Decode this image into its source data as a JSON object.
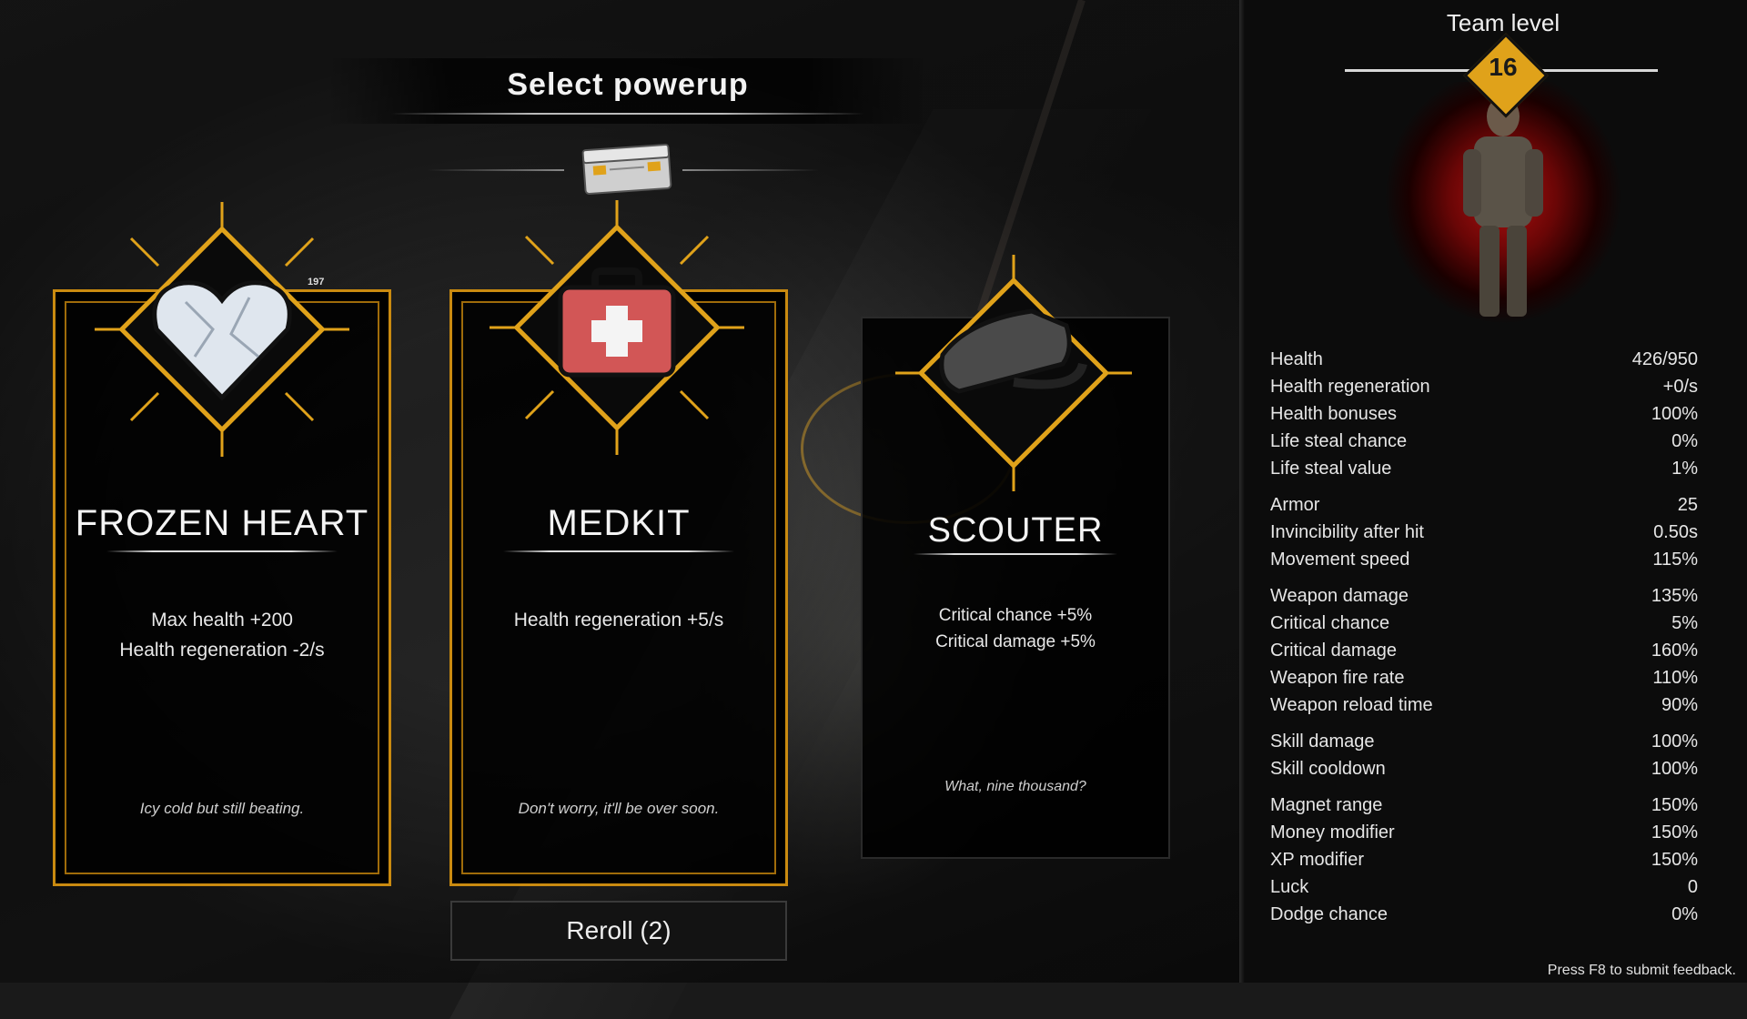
{
  "header": {
    "title": "Select powerup"
  },
  "cards": [
    {
      "name": "FROZEN HEART",
      "effects": [
        "Max health +200",
        "Health regeneration -2/s"
      ],
      "flavor": "Icy cold but still beating.",
      "badge": "197",
      "icon": "frozen-heart-icon"
    },
    {
      "name": "MEDKIT",
      "effects": [
        "Health regeneration +5/s"
      ],
      "flavor": "Don't worry, it'll be over soon.",
      "icon": "medkit-icon"
    },
    {
      "name": "SCOUTER",
      "effects": [
        "Critical chance +5%",
        "Critical damage +5%"
      ],
      "flavor": "What, nine thousand?",
      "icon": "scouter-icon"
    }
  ],
  "reroll": {
    "label": "Reroll (2)"
  },
  "panel": {
    "team_label": "Team level",
    "level": "16",
    "stat_groups": [
      [
        {
          "label": "Health",
          "value": "426/950"
        },
        {
          "label": "Health regeneration",
          "value": "+0/s"
        },
        {
          "label": "Health bonuses",
          "value": "100%"
        },
        {
          "label": "Life steal chance",
          "value": "0%"
        },
        {
          "label": "Life steal value",
          "value": "1%"
        }
      ],
      [
        {
          "label": "Armor",
          "value": "25"
        },
        {
          "label": "Invincibility after hit",
          "value": "0.50s"
        },
        {
          "label": "Movement speed",
          "value": "115%"
        }
      ],
      [
        {
          "label": "Weapon damage",
          "value": "135%"
        },
        {
          "label": "Critical chance",
          "value": "5%"
        },
        {
          "label": "Critical damage",
          "value": "160%"
        },
        {
          "label": "Weapon fire rate",
          "value": "110%"
        },
        {
          "label": "Weapon reload time",
          "value": "90%"
        }
      ],
      [
        {
          "label": "Skill damage",
          "value": "100%"
        },
        {
          "label": "Skill cooldown",
          "value": "100%"
        }
      ],
      [
        {
          "label": "Magnet range",
          "value": "150%"
        },
        {
          "label": "Money modifier",
          "value": "150%"
        },
        {
          "label": "XP modifier",
          "value": "150%"
        },
        {
          "label": "Luck",
          "value": "0"
        },
        {
          "label": "Dodge chance",
          "value": "0%"
        }
      ]
    ],
    "feedback": "Press F8 to submit feedback."
  },
  "colors": {
    "accent_gold": "#e0a21a",
    "card_border": "#c98a10",
    "portrait_red": "#b01010"
  }
}
